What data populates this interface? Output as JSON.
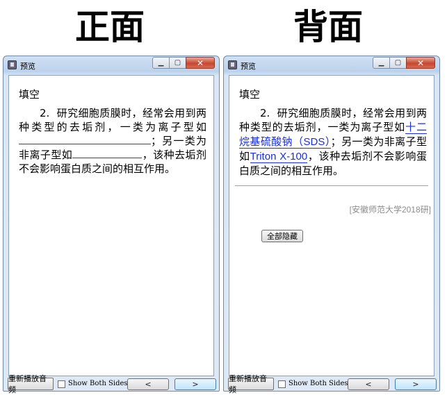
{
  "headings": {
    "front": "正面",
    "back": "背面"
  },
  "window": {
    "title": "预览",
    "icons": {
      "app": "app-icon",
      "minimize": "minimize-icon",
      "maximize": "maximize-icon",
      "close": "close-icon"
    },
    "minimize_glyph": "▁",
    "maximize_glyph": "▢",
    "close_glyph": "✕"
  },
  "front": {
    "type": "填空",
    "number": "2.",
    "text_a": "研究细胞质膜时，经常会用到两种类型的去垢剂，一类为离子型如",
    "text_b": "；另一类为非离子型如",
    "text_c": "，该种去垢剂不会影响蛋白质之间的相互作用。"
  },
  "back": {
    "type": "填空",
    "number": "2.",
    "text_a": "研究细胞质膜时，经常会用到两种类型的去垢剂，一类为离子型如",
    "answer1": "十二烷基硫酸钠（SDS）",
    "text_b": "；另一类为非离子型如",
    "answer2": "Triton X-100",
    "text_c": "，该种去垢剂不会影响蛋白质之间的相互作用。",
    "source": "[安徽师范大学2018研]",
    "hide_all_label": "全部隐藏"
  },
  "bottom": {
    "replay_label": "重新播放音频",
    "show_both_label": "Show Both Sides",
    "show_both_checked": false,
    "prev_glyph": "<",
    "next_glyph": ">"
  }
}
